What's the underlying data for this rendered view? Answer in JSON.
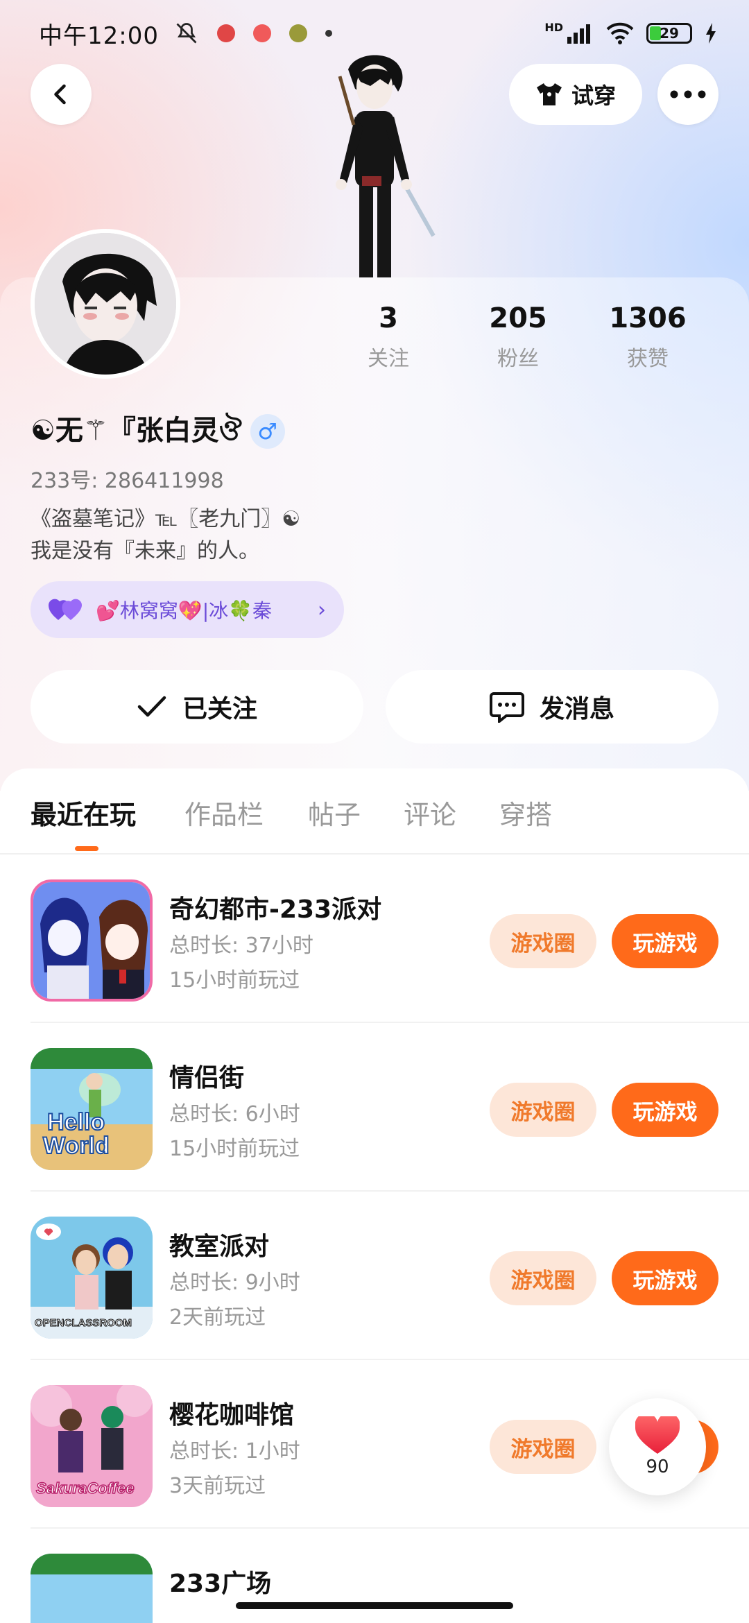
{
  "status": {
    "time": "中午12:00",
    "battery": "29",
    "network": "HD"
  },
  "header": {
    "try_label": "试穿"
  },
  "profile": {
    "stats": [
      {
        "value": "3",
        "label": "关注"
      },
      {
        "value": "205",
        "label": "粉丝"
      },
      {
        "value": "1306",
        "label": "获赞"
      }
    ],
    "nickname": "☯无⚚『张白灵ঔ",
    "gender": "♂",
    "uid": "233号: 286411998",
    "bio": "《盗墓笔记》℡〖老九门〗☯\n我是没有『未来』的人。",
    "relation": "💕林窝窝💖|冰🍀秦",
    "follow_label": "已关注",
    "message_label": "发消息"
  },
  "tabs": [
    "最近在玩",
    "作品栏",
    "帖子",
    "评论",
    "穿搭"
  ],
  "games": [
    {
      "name": "奇幻都市-233派对",
      "duration": "总时长: 37小时",
      "last": "15小时前玩过",
      "circle": "游戏圈",
      "play": "玩游戏"
    },
    {
      "name": "情侣街",
      "duration": "总时长: 6小时",
      "last": "15小时前玩过",
      "circle": "游戏圈",
      "play": "玩游戏"
    },
    {
      "name": "教室派对",
      "duration": "总时长: 9小时",
      "last": "2天前玩过",
      "circle": "游戏圈",
      "play": "玩游戏"
    },
    {
      "name": "樱花咖啡馆",
      "duration": "总时长: 1小时",
      "last": "3天前玩过",
      "circle": "游戏圈",
      "play": "玩游戏"
    },
    {
      "name": "233广场",
      "duration": "",
      "last": "",
      "circle": "",
      "play": ""
    }
  ],
  "thumb_text": {
    "hello": "Hello",
    "world": "World",
    "classroom": "OPENCLASSROOM",
    "sakura": "SakuraCoffee"
  },
  "like": {
    "count": "90"
  },
  "colors": {
    "accent": "#ff6a1a",
    "pill_bg": "#fde6d8",
    "relation_bg": "#e9e2fb"
  }
}
